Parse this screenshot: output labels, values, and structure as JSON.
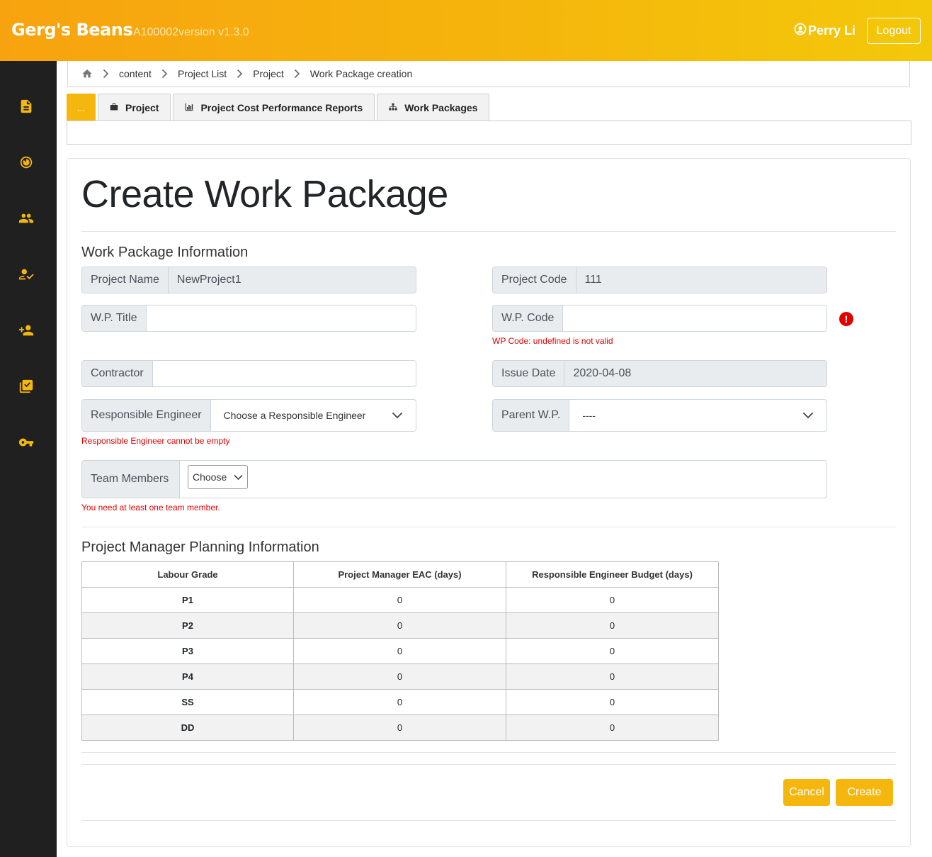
{
  "app": {
    "brand": "Gerg's Beans",
    "version": "A100002version v1.3.0",
    "user": "Perry Li",
    "logout_label": "Logout",
    "accent_color": "#f5b70e",
    "sidebar_icons": [
      "document-icon",
      "timer-icon",
      "people-icon",
      "user-check-icon",
      "add-user-icon",
      "checklist-icon",
      "key-icon"
    ]
  },
  "breadcrumb": {
    "items": [
      "content",
      "Project List",
      "Project",
      "Work Package creation"
    ]
  },
  "tabs": {
    "active_label": "...",
    "items": [
      {
        "label": "Project",
        "icon": "briefcase-icon"
      },
      {
        "label": "Project Cost Performance Reports",
        "icon": "bar-chart-icon"
      },
      {
        "label": "Work Packages",
        "icon": "sitemap-icon"
      }
    ]
  },
  "page": {
    "title": "Create Work Package"
  },
  "wp_info": {
    "section_title": "Work Package Information",
    "project_name_label": "Project Name",
    "project_name_value": "NewProject1",
    "project_code_label": "Project Code",
    "project_code_value": "111",
    "wp_title_label": "W.P. Title",
    "wp_title_value": "",
    "wp_code_label": "W.P. Code",
    "wp_code_value": "",
    "wp_code_error": "WP Code: undefined is not valid",
    "contractor_label": "Contractor",
    "contractor_value": "",
    "issue_date_label": "Issue Date",
    "issue_date_value": "2020-04-08",
    "engineer_label": "Responsible Engineer",
    "engineer_value": "Choose a Responsible Engineer",
    "engineer_error": "Responsible Engineer cannot be empty",
    "parent_label": "Parent W.P.",
    "parent_value": "----",
    "team_label": "Team Members",
    "team_choose": "Choose",
    "team_error": "You need at least one team member."
  },
  "planning": {
    "section_title": "Project Manager Planning Information",
    "headers": [
      "Labour Grade",
      "Project Manager EAC (days)",
      "Responsible Engineer Budget (days)"
    ],
    "rows": [
      {
        "grade": "P1",
        "eac": "0",
        "budget": "0"
      },
      {
        "grade": "P2",
        "eac": "0",
        "budget": "0"
      },
      {
        "grade": "P3",
        "eac": "0",
        "budget": "0"
      },
      {
        "grade": "P4",
        "eac": "0",
        "budget": "0"
      },
      {
        "grade": "SS",
        "eac": "0",
        "budget": "0"
      },
      {
        "grade": "DD",
        "eac": "0",
        "budget": "0"
      }
    ]
  },
  "actions": {
    "cancel_label": "Cancel",
    "create_label": "Create"
  }
}
